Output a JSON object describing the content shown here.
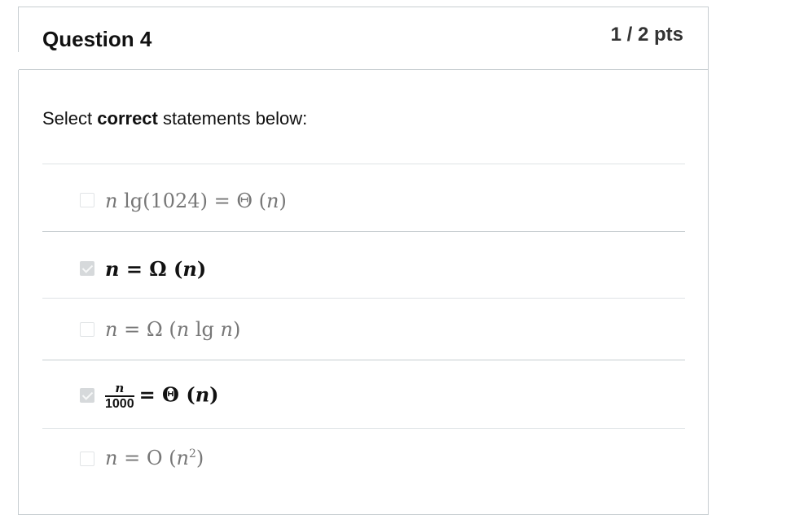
{
  "question": {
    "title": "Question 4",
    "points": "1 / 2 pts"
  },
  "prompt": {
    "prefix": "Select ",
    "emphasis": "correct",
    "suffix": " statements below:"
  },
  "answers": [
    {
      "checked": false,
      "math": {
        "a": "n",
        "b": " lg(1024) ",
        "eq": "=",
        "c": " Θ (",
        "d": "n",
        "e": ")"
      }
    },
    {
      "checked": true,
      "math": {
        "a": "n",
        "eq": "=",
        "c": " Ω (",
        "d": "n",
        "e": ")"
      }
    },
    {
      "checked": false,
      "math": {
        "a": "n",
        "eq": "=",
        "c": " Ω (",
        "d": "n",
        "b": " lg ",
        "f": "n",
        "e": ")"
      }
    },
    {
      "checked": true,
      "math": {
        "num": "n",
        "den": "1000",
        "eq": "=",
        "c": " Θ (",
        "d": "n",
        "e": ")"
      }
    },
    {
      "checked": false,
      "math": {
        "a": "n",
        "eq": "=",
        "c": " O (",
        "d": "n",
        "exp": "2",
        "e": ")"
      }
    }
  ]
}
